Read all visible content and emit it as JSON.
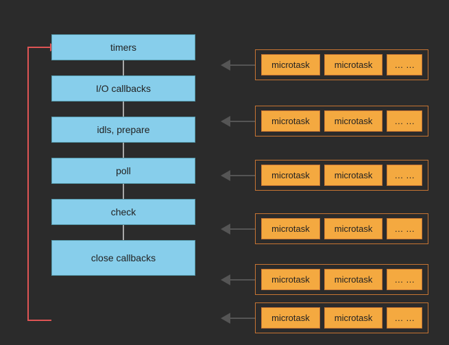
{
  "phases": [
    {
      "id": "timers",
      "label": "timers"
    },
    {
      "id": "io-callbacks",
      "label": "I/O callbacks"
    },
    {
      "id": "idls-prepare",
      "label": "idls, prepare"
    },
    {
      "id": "poll",
      "label": "poll"
    },
    {
      "id": "check",
      "label": "check"
    },
    {
      "id": "close-callbacks",
      "label": "close callbacks"
    }
  ],
  "microtask_rows": [
    {
      "id": "row-timers",
      "items": [
        "microtask",
        "microtask",
        "… …"
      ]
    },
    {
      "id": "row-io",
      "items": [
        "microtask",
        "microtask",
        "… …"
      ]
    },
    {
      "id": "row-idls",
      "items": [
        "microtask",
        "microtask",
        "… …"
      ]
    },
    {
      "id": "row-poll",
      "items": [
        "microtask",
        "microtask",
        "… …"
      ]
    },
    {
      "id": "row-check",
      "items": [
        "microtask",
        "microtask",
        "… …"
      ]
    },
    {
      "id": "row-close",
      "items": [
        "microtask",
        "microtask",
        "… …"
      ]
    }
  ],
  "colors": {
    "background": "#2b2b2b",
    "phase_box_bg": "#87ceeb",
    "phase_box_border": "#5599aa",
    "microtask_bg": "#f4a940",
    "microtask_border": "#c87533",
    "loop_arrow": "#e05555",
    "connector": "#aaaaaa"
  }
}
